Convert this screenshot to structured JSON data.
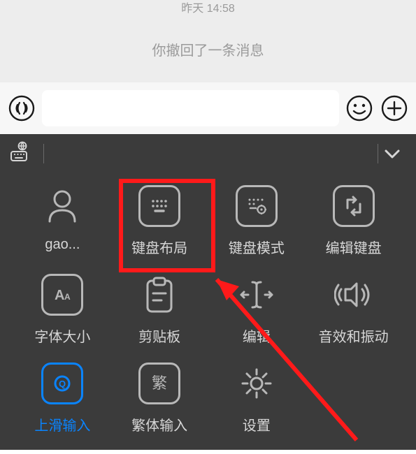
{
  "chat": {
    "timestamp": "昨天 14:58",
    "recall_message": "你撤回了一条消息"
  },
  "input": {
    "placeholder": ""
  },
  "keyboard": {
    "grid": [
      {
        "label": "gao...",
        "icon": "user"
      },
      {
        "label": "键盘布局",
        "icon": "keyboard-layout",
        "highlighted": true
      },
      {
        "label": "键盘模式",
        "icon": "keyboard-mode"
      },
      {
        "label": "编辑键盘",
        "icon": "edit-keyboard"
      },
      {
        "label": "字体大小",
        "icon": "font-size"
      },
      {
        "label": "剪贴板",
        "icon": "clipboard"
      },
      {
        "label": "编辑",
        "icon": "edit-cursor"
      },
      {
        "label": "音效和振动",
        "icon": "sound-vibration"
      },
      {
        "label": "上滑输入",
        "icon": "swipe-input",
        "active": true
      },
      {
        "label": "繁体输入",
        "icon": "traditional"
      },
      {
        "label": "设置",
        "icon": "settings"
      }
    ]
  },
  "annotation": {
    "highlight_index": 1
  }
}
